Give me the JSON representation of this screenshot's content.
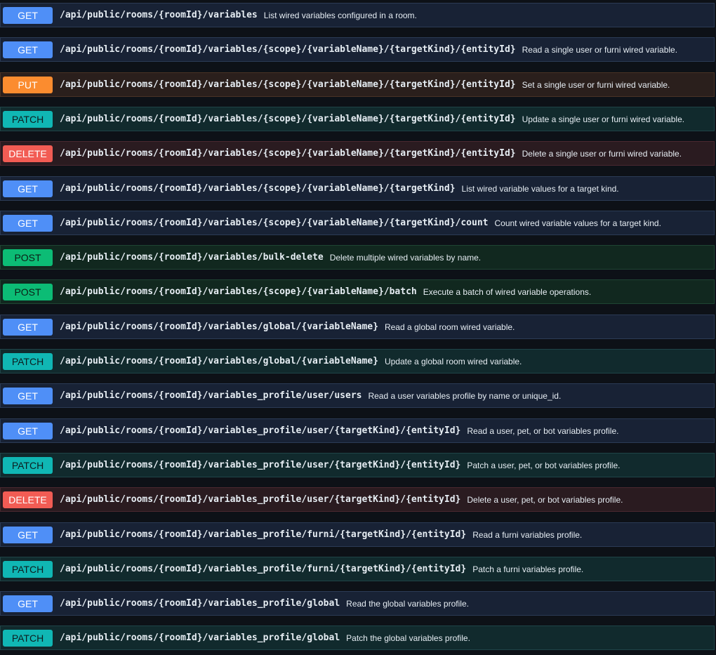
{
  "colors": {
    "get": "#4f8ff7",
    "put": "#fb8c2f",
    "patch": "#10b7b4",
    "delete": "#f25c54",
    "post": "#0cbc75",
    "background": "#0d1117"
  },
  "operations": [
    {
      "method": "GET",
      "path": "/api/public/rooms/{roomId}/variables",
      "summary": "List wired variables configured in a room."
    },
    {
      "method": "GET",
      "path": "/api/public/rooms/{roomId}/variables/{scope}/{variableName}/{targetKind}/{entityId}",
      "summary": "Read a single user or furni wired variable."
    },
    {
      "method": "PUT",
      "path": "/api/public/rooms/{roomId}/variables/{scope}/{variableName}/{targetKind}/{entityId}",
      "summary": "Set a single user or furni wired variable."
    },
    {
      "method": "PATCH",
      "path": "/api/public/rooms/{roomId}/variables/{scope}/{variableName}/{targetKind}/{entityId}",
      "summary": "Update a single user or furni wired variable."
    },
    {
      "method": "DELETE",
      "path": "/api/public/rooms/{roomId}/variables/{scope}/{variableName}/{targetKind}/{entityId}",
      "summary": "Delete a single user or furni wired variable."
    },
    {
      "method": "GET",
      "path": "/api/public/rooms/{roomId}/variables/{scope}/{variableName}/{targetKind}",
      "summary": "List wired variable values for a target kind."
    },
    {
      "method": "GET",
      "path": "/api/public/rooms/{roomId}/variables/{scope}/{variableName}/{targetKind}/count",
      "summary": "Count wired variable values for a target kind."
    },
    {
      "method": "POST",
      "path": "/api/public/rooms/{roomId}/variables/bulk-delete",
      "summary": "Delete multiple wired variables by name."
    },
    {
      "method": "POST",
      "path": "/api/public/rooms/{roomId}/variables/{scope}/{variableName}/batch",
      "summary": "Execute a batch of wired variable operations."
    },
    {
      "method": "GET",
      "path": "/api/public/rooms/{roomId}/variables/global/{variableName}",
      "summary": "Read a global room wired variable."
    },
    {
      "method": "PATCH",
      "path": "/api/public/rooms/{roomId}/variables/global/{variableName}",
      "summary": "Update a global room wired variable."
    },
    {
      "method": "GET",
      "path": "/api/public/rooms/{roomId}/variables_profile/user/users",
      "summary": "Read a user variables profile by name or unique_id."
    },
    {
      "method": "GET",
      "path": "/api/public/rooms/{roomId}/variables_profile/user/{targetKind}/{entityId}",
      "summary": "Read a user, pet, or bot variables profile."
    },
    {
      "method": "PATCH",
      "path": "/api/public/rooms/{roomId}/variables_profile/user/{targetKind}/{entityId}",
      "summary": "Patch a user, pet, or bot variables profile."
    },
    {
      "method": "DELETE",
      "path": "/api/public/rooms/{roomId}/variables_profile/user/{targetKind}/{entityId}",
      "summary": "Delete a user, pet, or bot variables profile."
    },
    {
      "method": "GET",
      "path": "/api/public/rooms/{roomId}/variables_profile/furni/{targetKind}/{entityId}",
      "summary": "Read a furni variables profile."
    },
    {
      "method": "PATCH",
      "path": "/api/public/rooms/{roomId}/variables_profile/furni/{targetKind}/{entityId}",
      "summary": "Patch a furni variables profile."
    },
    {
      "method": "GET",
      "path": "/api/public/rooms/{roomId}/variables_profile/global",
      "summary": "Read the global variables profile."
    },
    {
      "method": "PATCH",
      "path": "/api/public/rooms/{roomId}/variables_profile/global",
      "summary": "Patch the global variables profile."
    }
  ]
}
